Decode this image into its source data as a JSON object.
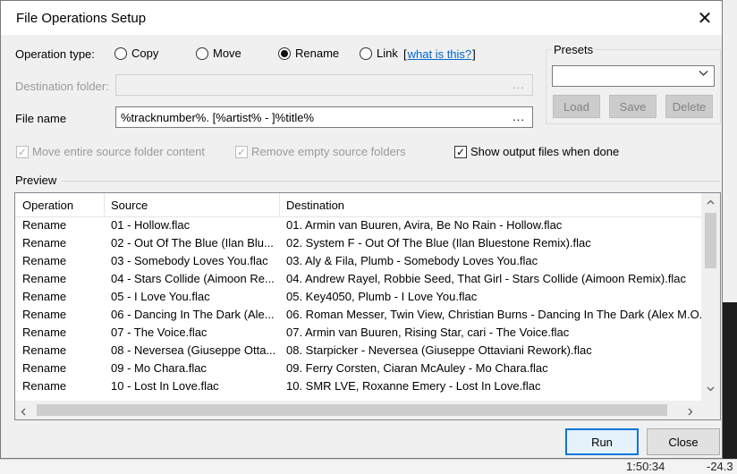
{
  "dialog": {
    "title": "File Operations Setup",
    "close_glyph": "✕"
  },
  "operation": {
    "label": "Operation type:",
    "options": [
      {
        "label": "Copy",
        "selected": false
      },
      {
        "label": "Move",
        "selected": false
      },
      {
        "label": "Rename",
        "selected": true
      },
      {
        "label": "Link",
        "selected": false
      }
    ],
    "help_open": "[",
    "help_link": "what is this?",
    "help_close": "]"
  },
  "destination": {
    "label": "Destination folder:",
    "value": "",
    "browse": "..."
  },
  "filename": {
    "label": "File name",
    "value": "%tracknumber%. [%artist% - ]%title%",
    "browse": "..."
  },
  "options": {
    "move_entire": {
      "label": "Move entire source folder content",
      "checked": true,
      "enabled": false
    },
    "remove_empty": {
      "label": "Remove empty source folders",
      "checked": true,
      "enabled": false
    },
    "show_output": {
      "label": "Show output files when done",
      "checked": true,
      "enabled": true
    }
  },
  "presets": {
    "title": "Presets",
    "selected": "",
    "load": "Load",
    "save": "Save",
    "delete": "Delete"
  },
  "preview": {
    "label": "Preview",
    "columns": [
      "Operation",
      "Source",
      "Destination"
    ],
    "rows": [
      [
        "Rename",
        "01 - Hollow.flac",
        "01. Armin van Buuren, Avira, Be No Rain - Hollow.flac"
      ],
      [
        "Rename",
        "02 - Out Of The Blue (Ilan Blu...",
        "02. System F - Out Of The Blue (Ilan Bluestone Remix).flac"
      ],
      [
        "Rename",
        "03 - Somebody Loves You.flac",
        "03. Aly & Fila, Plumb - Somebody Loves You.flac"
      ],
      [
        "Rename",
        "04 - Stars Collide (Aimoon Re...",
        "04. Andrew Rayel, Robbie Seed, That Girl - Stars Collide (Aimoon Remix).flac"
      ],
      [
        "Rename",
        "05 - I Love You.flac",
        "05. Key4050, Plumb - I Love You.flac"
      ],
      [
        "Rename",
        "06 - Dancing In The Dark (Ale...",
        "06. Roman Messer, Twin View, Christian Burns - Dancing In The Dark (Alex M.O..."
      ],
      [
        "Rename",
        "07 - The Voice.flac",
        "07. Armin van Buuren, Rising Star, cari - The Voice.flac"
      ],
      [
        "Rename",
        "08 - Neversea (Giuseppe Otta...",
        "08. Starpicker - Neversea (Giuseppe Ottaviani Rework).flac"
      ],
      [
        "Rename",
        "09 - Mo Chara.flac",
        "09. Ferry Corsten, Ciaran McAuley - Mo Chara.flac"
      ],
      [
        "Rename",
        "10 - Lost In Love.flac",
        "10. SMR LVE, Roxanne Emery - Lost In Love.flac"
      ]
    ]
  },
  "buttons": {
    "run": "Run",
    "close": "Close"
  },
  "background": {
    "time": "1:50:34",
    "value": "-24.3"
  }
}
